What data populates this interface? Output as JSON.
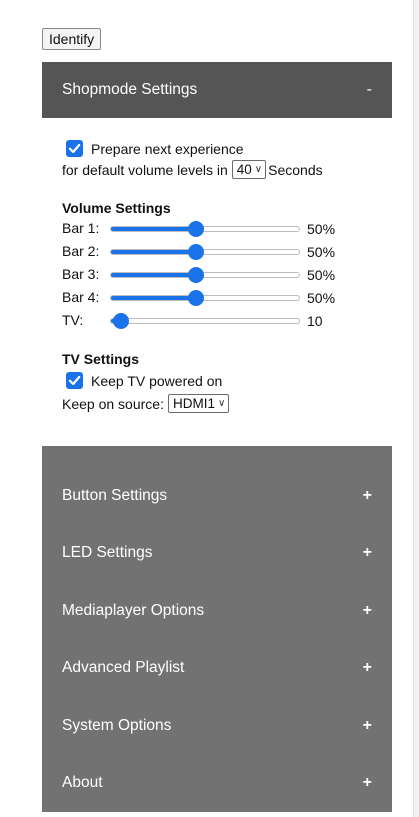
{
  "identify_button": "Identify",
  "shopmode": {
    "title": "Shopmode Settings",
    "toggle": "-",
    "prepare_label": "Prepare next experience",
    "default_volume_prefix": "for default volume levels in",
    "seconds_value": "40",
    "seconds_suffix": "Seconds",
    "volume_heading": "Volume Settings",
    "sliders": [
      {
        "label": "Bar 1:",
        "value": "50%",
        "fraction": 0.45
      },
      {
        "label": "Bar 2:",
        "value": "50%",
        "fraction": 0.45
      },
      {
        "label": "Bar 3:",
        "value": "50%",
        "fraction": 0.45
      },
      {
        "label": "Bar 4:",
        "value": "50%",
        "fraction": 0.45
      },
      {
        "label": "TV:",
        "value": "10",
        "fraction": 0.06
      }
    ],
    "tv_heading": "TV Settings",
    "keep_tv_label": "Keep TV powered on",
    "keep_source_label": "Keep on source:",
    "source_value": "HDMI1"
  },
  "sections": [
    {
      "label": "Button Settings",
      "toggle": "+"
    },
    {
      "label": "LED Settings",
      "toggle": "+"
    },
    {
      "label": "Mediaplayer Options",
      "toggle": "+"
    },
    {
      "label": "Advanced Playlist",
      "toggle": "+"
    },
    {
      "label": "System Options",
      "toggle": "+"
    },
    {
      "label": "About",
      "toggle": "+"
    }
  ],
  "colors": {
    "accent": "#1a73e8",
    "open_header": "#555555",
    "collapsed_header": "#727272"
  }
}
